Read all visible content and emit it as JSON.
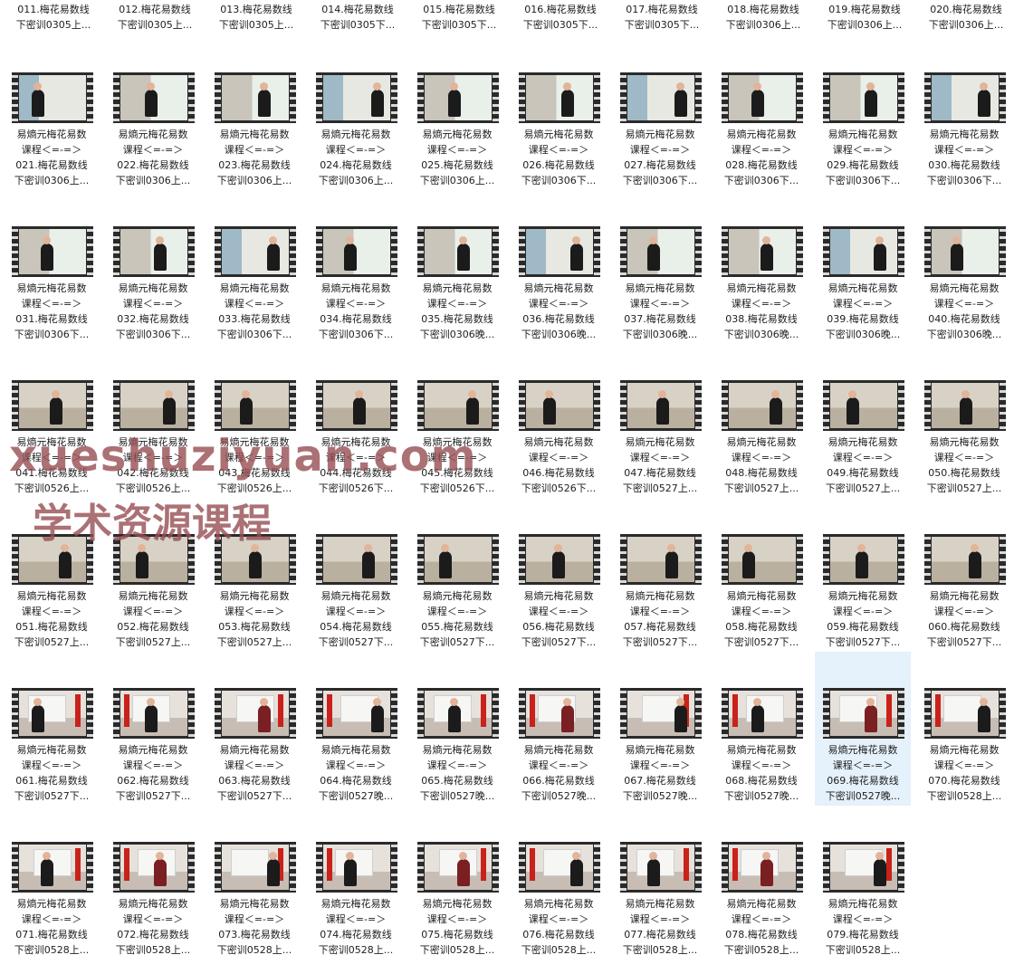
{
  "top_row": [
    {
      "line1": "011.梅花易数线",
      "line2": "下密训0305上..."
    },
    {
      "line1": "012.梅花易数线",
      "line2": "下密训0305上..."
    },
    {
      "line1": "013.梅花易数线",
      "line2": "下密训0305上..."
    },
    {
      "line1": "014.梅花易数线",
      "line2": "下密训0305下..."
    },
    {
      "line1": "015.梅花易数线",
      "line2": "下密训0305下..."
    },
    {
      "line1": "016.梅花易数线",
      "line2": "下密训0305下..."
    },
    {
      "line1": "017.梅花易数线",
      "line2": "下密训0305下..."
    },
    {
      "line1": "018.梅花易数线",
      "line2": "下密训0306上..."
    },
    {
      "line1": "019.梅花易数线",
      "line2": "下密训0306上..."
    },
    {
      "line1": "020.梅花易数线",
      "line2": "下密训0306上..."
    }
  ],
  "common": {
    "title_line": "易熵元梅花易数",
    "subtitle_line": "课程＜=-=＞"
  },
  "files": [
    {
      "num_line": "021.梅花易数线",
      "suffix_line": "下密训0306上..."
    },
    {
      "num_line": "022.梅花易数线",
      "suffix_line": "下密训0306上..."
    },
    {
      "num_line": "023.梅花易数线",
      "suffix_line": "下密训0306上..."
    },
    {
      "num_line": "024.梅花易数线",
      "suffix_line": "下密训0306上..."
    },
    {
      "num_line": "025.梅花易数线",
      "suffix_line": "下密训0306上..."
    },
    {
      "num_line": "026.梅花易数线",
      "suffix_line": "下密训0306下..."
    },
    {
      "num_line": "027.梅花易数线",
      "suffix_line": "下密训0306下..."
    },
    {
      "num_line": "028.梅花易数线",
      "suffix_line": "下密训0306下..."
    },
    {
      "num_line": "029.梅花易数线",
      "suffix_line": "下密训0306下..."
    },
    {
      "num_line": "030.梅花易数线",
      "suffix_line": "下密训0306下..."
    },
    {
      "num_line": "031.梅花易数线",
      "suffix_line": "下密训0306下..."
    },
    {
      "num_line": "032.梅花易数线",
      "suffix_line": "下密训0306下..."
    },
    {
      "num_line": "033.梅花易数线",
      "suffix_line": "下密训0306下..."
    },
    {
      "num_line": "034.梅花易数线",
      "suffix_line": "下密训0306下..."
    },
    {
      "num_line": "035.梅花易数线",
      "suffix_line": "下密训0306晚..."
    },
    {
      "num_line": "036.梅花易数线",
      "suffix_line": "下密训0306晚..."
    },
    {
      "num_line": "037.梅花易数线",
      "suffix_line": "下密训0306晚..."
    },
    {
      "num_line": "038.梅花易数线",
      "suffix_line": "下密训0306晚..."
    },
    {
      "num_line": "039.梅花易数线",
      "suffix_line": "下密训0306晚..."
    },
    {
      "num_line": "040.梅花易数线",
      "suffix_line": "下密训0306晚..."
    },
    {
      "num_line": "041.梅花易数线",
      "suffix_line": "下密训0526上..."
    },
    {
      "num_line": "042.梅花易数线",
      "suffix_line": "下密训0526上..."
    },
    {
      "num_line": "043.梅花易数线",
      "suffix_line": "下密训0526上..."
    },
    {
      "num_line": "044.梅花易数线",
      "suffix_line": "下密训0526下..."
    },
    {
      "num_line": "045.梅花易数线",
      "suffix_line": "下密训0526下..."
    },
    {
      "num_line": "046.梅花易数线",
      "suffix_line": "下密训0526下..."
    },
    {
      "num_line": "047.梅花易数线",
      "suffix_line": "下密训0527上..."
    },
    {
      "num_line": "048.梅花易数线",
      "suffix_line": "下密训0527上..."
    },
    {
      "num_line": "049.梅花易数线",
      "suffix_line": "下密训0527上..."
    },
    {
      "num_line": "050.梅花易数线",
      "suffix_line": "下密训0527上..."
    },
    {
      "num_line": "051.梅花易数线",
      "suffix_line": "下密训0527上..."
    },
    {
      "num_line": "052.梅花易数线",
      "suffix_line": "下密训0527上..."
    },
    {
      "num_line": "053.梅花易数线",
      "suffix_line": "下密训0527上..."
    },
    {
      "num_line": "054.梅花易数线",
      "suffix_line": "下密训0527下..."
    },
    {
      "num_line": "055.梅花易数线",
      "suffix_line": "下密训0527下..."
    },
    {
      "num_line": "056.梅花易数线",
      "suffix_line": "下密训0527下..."
    },
    {
      "num_line": "057.梅花易数线",
      "suffix_line": "下密训0527下..."
    },
    {
      "num_line": "058.梅花易数线",
      "suffix_line": "下密训0527下..."
    },
    {
      "num_line": "059.梅花易数线",
      "suffix_line": "下密训0527下..."
    },
    {
      "num_line": "060.梅花易数线",
      "suffix_line": "下密训0527下..."
    },
    {
      "num_line": "061.梅花易数线",
      "suffix_line": "下密训0527下..."
    },
    {
      "num_line": "062.梅花易数线",
      "suffix_line": "下密训0527下..."
    },
    {
      "num_line": "063.梅花易数线",
      "suffix_line": "下密训0527下..."
    },
    {
      "num_line": "064.梅花易数线",
      "suffix_line": "下密训0527晚..."
    },
    {
      "num_line": "065.梅花易数线",
      "suffix_line": "下密训0527晚..."
    },
    {
      "num_line": "066.梅花易数线",
      "suffix_line": "下密训0527晚..."
    },
    {
      "num_line": "067.梅花易数线",
      "suffix_line": "下密训0527晚..."
    },
    {
      "num_line": "068.梅花易数线",
      "suffix_line": "下密训0527晚..."
    },
    {
      "num_line": "069.梅花易数线",
      "suffix_line": "下密训0527晚...",
      "selected": true
    },
    {
      "num_line": "070.梅花易数线",
      "suffix_line": "下密训0528上..."
    },
    {
      "num_line": "071.梅花易数线",
      "suffix_line": "下密训0528上..."
    },
    {
      "num_line": "072.梅花易数线",
      "suffix_line": "下密训0528上..."
    },
    {
      "num_line": "073.梅花易数线",
      "suffix_line": "下密训0528上..."
    },
    {
      "num_line": "074.梅花易数线",
      "suffix_line": "下密训0528上..."
    },
    {
      "num_line": "075.梅花易数线",
      "suffix_line": "下密训0528上..."
    },
    {
      "num_line": "076.梅花易数线",
      "suffix_line": "下密训0528上..."
    },
    {
      "num_line": "077.梅花易数线",
      "suffix_line": "下密训0528上..."
    },
    {
      "num_line": "078.梅花易数线",
      "suffix_line": "下密训0528上..."
    },
    {
      "num_line": "079.梅花易数线",
      "suffix_line": "下密训0528上..."
    }
  ],
  "watermark": {
    "line1": "xueshuziyuan.com",
    "line2": "学术资源课程"
  },
  "colors": {
    "selection": "#e5f1fb",
    "watermark": "#964e52",
    "flag_red": "#c8221b"
  }
}
